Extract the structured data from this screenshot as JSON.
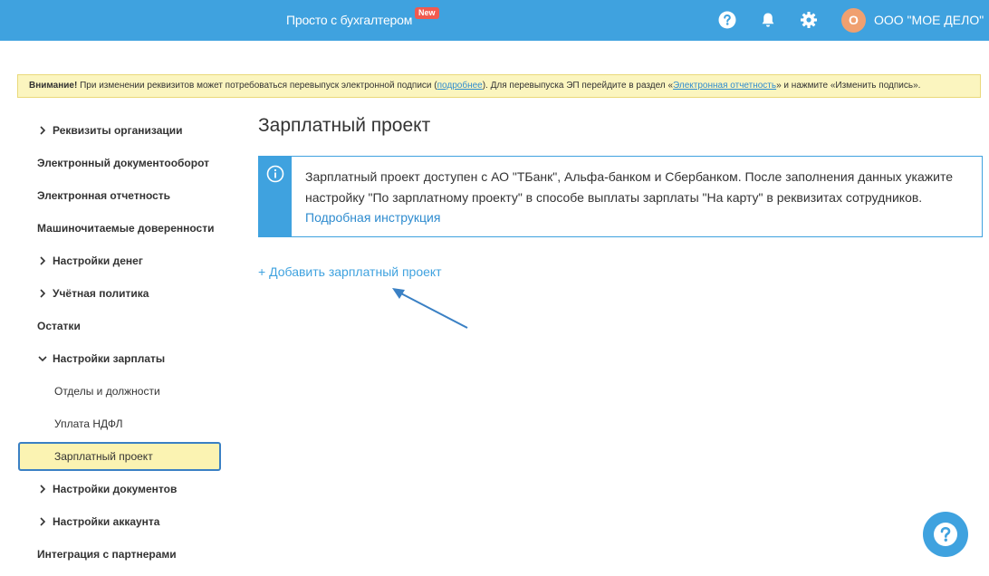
{
  "header": {
    "promo_text": "Просто с бухгалтером",
    "new_badge": "New",
    "avatar_letter": "О",
    "org_name": "ООО \"МОЕ ДЕЛО\"",
    "icons": [
      "help-icon",
      "bell-icon",
      "gear-icon"
    ]
  },
  "warning": {
    "bold": "Внимание!",
    "text1": " При изменении реквизитов может потребоваться перевыпуск электронной подписи (",
    "link1": "подробнее",
    "text2": "). Для перевыпуска ЭП перейдите в раздел «",
    "link2": "Электронная отчетность",
    "text3": "» и нажмите «Изменить подпись»."
  },
  "sidebar": {
    "items": [
      {
        "label": "Реквизиты организации",
        "chevron": "right"
      },
      {
        "label": "Электронный документооборот"
      },
      {
        "label": "Электронная отчетность"
      },
      {
        "label": "Машиночитаемые доверенности"
      },
      {
        "label": "Настройки денег",
        "chevron": "right"
      },
      {
        "label": "Учётная политика",
        "chevron": "right"
      },
      {
        "label": "Остатки"
      },
      {
        "label": "Настройки зарплаты",
        "chevron": "down"
      },
      {
        "label": "Отделы и должности",
        "sub": true
      },
      {
        "label": "Уплата НДФЛ",
        "sub": true
      },
      {
        "label": "Зарплатный проект",
        "sub": true,
        "active": true
      },
      {
        "label": "Настройки документов",
        "chevron": "right"
      },
      {
        "label": "Настройки аккаунта",
        "chevron": "right"
      },
      {
        "label": "Интеграция с партнерами"
      }
    ]
  },
  "main": {
    "title": "Зарплатный проект",
    "info_text": "Зарплатный проект доступен с АО \"ТБанк\", Альфа-банком и Сбербанком. После заполнения данных укажите настройку \"По зарплатному проекту\" в способе выплаты зарплаты \"На карту\" в реквизитах сотрудников.",
    "info_link": "Подробная инструкция",
    "add_link": "+ Добавить зарплатный проект"
  },
  "colors": {
    "header_bg": "#3fa2df",
    "accent": "#3fa2df",
    "warning_bg": "#fbf5bf",
    "active_item_bg": "#fbf3b2",
    "active_item_border": "#3a80c4"
  }
}
